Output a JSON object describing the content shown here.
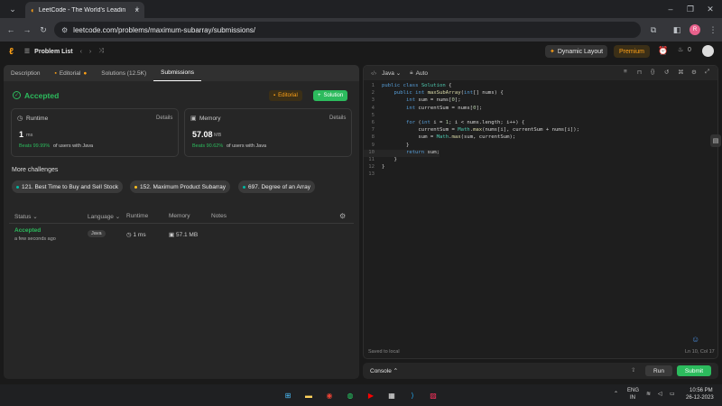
{
  "browser": {
    "tab_title": "LeetCode - The World's Leadin",
    "tab_close": "×",
    "new_tab": "+",
    "url": "leetcode.com/problems/maximum-subarray/submissions/",
    "profile_initial": "R"
  },
  "header": {
    "problem_list": "Problem List",
    "dynamic_layout": "Dynamic Layout",
    "premium": "Premium",
    "streak": "0"
  },
  "left_tabs": [
    "Description",
    "Editorial",
    "Solutions (12.5K)",
    "Submissions"
  ],
  "result": {
    "status": "Accepted",
    "editorial_btn": "Editorial",
    "solution_btn": "Solution",
    "runtime_label": "Runtime",
    "runtime_details": "Details",
    "runtime_value": "1",
    "runtime_unit": "ms",
    "runtime_beats_pct": "Beats 99.99%",
    "runtime_beats_rest": "of users with Java",
    "memory_label": "Memory",
    "memory_details": "Details",
    "memory_value": "57.08",
    "memory_unit": "MB",
    "memory_beats_pct": "Beats 90.62%",
    "memory_beats_rest": "of users with Java"
  },
  "more_challenges": {
    "title": "More challenges",
    "items": [
      {
        "label": "121. Best Time to Buy and Sell Stock",
        "color": "#00b8a3"
      },
      {
        "label": "152. Maximum Product Subarray",
        "color": "#ffc01e"
      },
      {
        "label": "697. Degree of an Array",
        "color": "#00b8a3"
      }
    ]
  },
  "submissions_table": {
    "headers": [
      "Status",
      "Language",
      "Runtime",
      "Memory",
      "Notes"
    ],
    "rows": [
      {
        "status": "Accepted",
        "time": "a few seconds ago",
        "language": "Java",
        "runtime": "1 ms",
        "memory": "57.1 MB"
      }
    ]
  },
  "editor": {
    "language": "Java",
    "mode": "Auto",
    "saved": "Saved to local",
    "cursor": "Ln 10, Col 17",
    "lines": [
      "public class Solution {",
      "    public int maxSubArray(int[] nums) {",
      "        int sum = nums[0];",
      "        int currentSum = nums[0];",
      "",
      "        for (int i = 1; i < nums.length; i++) {",
      "            currentSum = Math.max(nums[i], currentSum + nums[i]);",
      "            sum = Math.max(sum, currentSum);",
      "        }",
      "        return sum;",
      "    }",
      "}",
      ""
    ]
  },
  "console": {
    "label": "Console",
    "run": "Run",
    "submit": "Submit"
  },
  "taskbar": {
    "lang": "ENG",
    "region": "IN",
    "time": "10:56 PM",
    "date": "26-12-2023"
  },
  "colors": {
    "accepted": "#2cbb5d",
    "submit": "#2cbb5d",
    "premium": "#ffa116"
  }
}
